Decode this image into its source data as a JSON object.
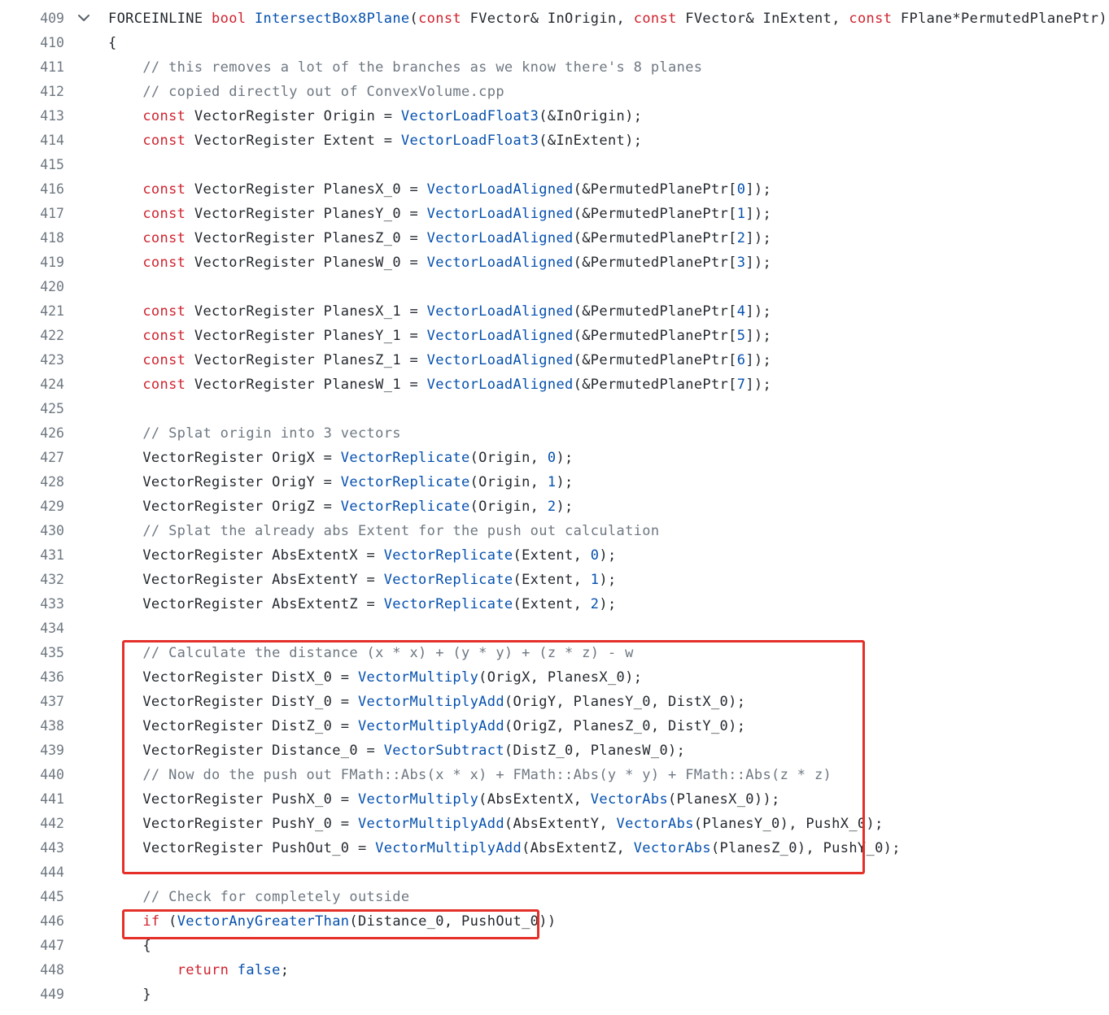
{
  "colors": {
    "keyword": "#cf222e",
    "function": "#0550ae",
    "comment": "#6e7781",
    "text": "#24292f",
    "line_number": "#6e7781",
    "highlight_box": "#e5302a"
  },
  "fold_icon": "chevron-down-icon",
  "lines": [
    {
      "n": "409",
      "fold": true,
      "tokens": [
        [
          "p",
          "FORCEINLINE "
        ],
        [
          "k",
          "bool"
        ],
        [
          "p",
          " "
        ],
        [
          "f",
          "IntersectBox8Plane"
        ],
        [
          "p",
          "("
        ],
        [
          "k",
          "const"
        ],
        [
          "p",
          " FVector& InOrigin, "
        ],
        [
          "k",
          "const"
        ],
        [
          "p",
          " FVector& InExtent, "
        ],
        [
          "k",
          "const"
        ],
        [
          "p",
          " FPlane*PermutedPlanePtr)"
        ]
      ]
    },
    {
      "n": "410",
      "tokens": [
        [
          "p",
          "{"
        ]
      ]
    },
    {
      "n": "411",
      "tokens": [
        [
          "p",
          "    "
        ],
        [
          "c",
          "// this removes a lot of the branches as we know there's 8 planes"
        ]
      ]
    },
    {
      "n": "412",
      "tokens": [
        [
          "p",
          "    "
        ],
        [
          "c",
          "// copied directly out of ConvexVolume.cpp"
        ]
      ]
    },
    {
      "n": "413",
      "tokens": [
        [
          "p",
          "    "
        ],
        [
          "k",
          "const"
        ],
        [
          "p",
          " VectorRegister Origin = "
        ],
        [
          "f",
          "VectorLoadFloat3"
        ],
        [
          "p",
          "(&InOrigin);"
        ]
      ]
    },
    {
      "n": "414",
      "tokens": [
        [
          "p",
          "    "
        ],
        [
          "k",
          "const"
        ],
        [
          "p",
          " VectorRegister Extent = "
        ],
        [
          "f",
          "VectorLoadFloat3"
        ],
        [
          "p",
          "(&InExtent);"
        ]
      ]
    },
    {
      "n": "415",
      "tokens": []
    },
    {
      "n": "416",
      "tokens": [
        [
          "p",
          "    "
        ],
        [
          "k",
          "const"
        ],
        [
          "p",
          " VectorRegister PlanesX_0 = "
        ],
        [
          "f",
          "VectorLoadAligned"
        ],
        [
          "p",
          "(&PermutedPlanePtr["
        ],
        [
          "n",
          "0"
        ],
        [
          "p",
          "]);"
        ]
      ]
    },
    {
      "n": "417",
      "tokens": [
        [
          "p",
          "    "
        ],
        [
          "k",
          "const"
        ],
        [
          "p",
          " VectorRegister PlanesY_0 = "
        ],
        [
          "f",
          "VectorLoadAligned"
        ],
        [
          "p",
          "(&PermutedPlanePtr["
        ],
        [
          "n",
          "1"
        ],
        [
          "p",
          "]);"
        ]
      ]
    },
    {
      "n": "418",
      "tokens": [
        [
          "p",
          "    "
        ],
        [
          "k",
          "const"
        ],
        [
          "p",
          " VectorRegister PlanesZ_0 = "
        ],
        [
          "f",
          "VectorLoadAligned"
        ],
        [
          "p",
          "(&PermutedPlanePtr["
        ],
        [
          "n",
          "2"
        ],
        [
          "p",
          "]);"
        ]
      ]
    },
    {
      "n": "419",
      "tokens": [
        [
          "p",
          "    "
        ],
        [
          "k",
          "const"
        ],
        [
          "p",
          " VectorRegister PlanesW_0 = "
        ],
        [
          "f",
          "VectorLoadAligned"
        ],
        [
          "p",
          "(&PermutedPlanePtr["
        ],
        [
          "n",
          "3"
        ],
        [
          "p",
          "]);"
        ]
      ]
    },
    {
      "n": "420",
      "tokens": []
    },
    {
      "n": "421",
      "tokens": [
        [
          "p",
          "    "
        ],
        [
          "k",
          "const"
        ],
        [
          "p",
          " VectorRegister PlanesX_1 = "
        ],
        [
          "f",
          "VectorLoadAligned"
        ],
        [
          "p",
          "(&PermutedPlanePtr["
        ],
        [
          "n",
          "4"
        ],
        [
          "p",
          "]);"
        ]
      ]
    },
    {
      "n": "422",
      "tokens": [
        [
          "p",
          "    "
        ],
        [
          "k",
          "const"
        ],
        [
          "p",
          " VectorRegister PlanesY_1 = "
        ],
        [
          "f",
          "VectorLoadAligned"
        ],
        [
          "p",
          "(&PermutedPlanePtr["
        ],
        [
          "n",
          "5"
        ],
        [
          "p",
          "]);"
        ]
      ]
    },
    {
      "n": "423",
      "tokens": [
        [
          "p",
          "    "
        ],
        [
          "k",
          "const"
        ],
        [
          "p",
          " VectorRegister PlanesZ_1 = "
        ],
        [
          "f",
          "VectorLoadAligned"
        ],
        [
          "p",
          "(&PermutedPlanePtr["
        ],
        [
          "n",
          "6"
        ],
        [
          "p",
          "]);"
        ]
      ]
    },
    {
      "n": "424",
      "tokens": [
        [
          "p",
          "    "
        ],
        [
          "k",
          "const"
        ],
        [
          "p",
          " VectorRegister PlanesW_1 = "
        ],
        [
          "f",
          "VectorLoadAligned"
        ],
        [
          "p",
          "(&PermutedPlanePtr["
        ],
        [
          "n",
          "7"
        ],
        [
          "p",
          "]);"
        ]
      ]
    },
    {
      "n": "425",
      "tokens": []
    },
    {
      "n": "426",
      "tokens": [
        [
          "p",
          "    "
        ],
        [
          "c",
          "// Splat origin into 3 vectors"
        ]
      ]
    },
    {
      "n": "427",
      "tokens": [
        [
          "p",
          "    VectorRegister OrigX = "
        ],
        [
          "f",
          "VectorReplicate"
        ],
        [
          "p",
          "(Origin, "
        ],
        [
          "n",
          "0"
        ],
        [
          "p",
          ");"
        ]
      ]
    },
    {
      "n": "428",
      "tokens": [
        [
          "p",
          "    VectorRegister OrigY = "
        ],
        [
          "f",
          "VectorReplicate"
        ],
        [
          "p",
          "(Origin, "
        ],
        [
          "n",
          "1"
        ],
        [
          "p",
          ");"
        ]
      ]
    },
    {
      "n": "429",
      "tokens": [
        [
          "p",
          "    VectorRegister OrigZ = "
        ],
        [
          "f",
          "VectorReplicate"
        ],
        [
          "p",
          "(Origin, "
        ],
        [
          "n",
          "2"
        ],
        [
          "p",
          ");"
        ]
      ]
    },
    {
      "n": "430",
      "tokens": [
        [
          "p",
          "    "
        ],
        [
          "c",
          "// Splat the already abs Extent for the push out calculation"
        ]
      ]
    },
    {
      "n": "431",
      "tokens": [
        [
          "p",
          "    VectorRegister AbsExtentX = "
        ],
        [
          "f",
          "VectorReplicate"
        ],
        [
          "p",
          "(Extent, "
        ],
        [
          "n",
          "0"
        ],
        [
          "p",
          ");"
        ]
      ]
    },
    {
      "n": "432",
      "tokens": [
        [
          "p",
          "    VectorRegister AbsExtentY = "
        ],
        [
          "f",
          "VectorReplicate"
        ],
        [
          "p",
          "(Extent, "
        ],
        [
          "n",
          "1"
        ],
        [
          "p",
          ");"
        ]
      ]
    },
    {
      "n": "433",
      "tokens": [
        [
          "p",
          "    VectorRegister AbsExtentZ = "
        ],
        [
          "f",
          "VectorReplicate"
        ],
        [
          "p",
          "(Extent, "
        ],
        [
          "n",
          "2"
        ],
        [
          "p",
          ");"
        ]
      ]
    },
    {
      "n": "434",
      "tokens": []
    },
    {
      "n": "435",
      "tokens": [
        [
          "p",
          "    "
        ],
        [
          "c",
          "// Calculate the distance (x * x) + (y * y) + (z * z) - w"
        ]
      ]
    },
    {
      "n": "436",
      "tokens": [
        [
          "p",
          "    VectorRegister DistX_0 = "
        ],
        [
          "f",
          "VectorMultiply"
        ],
        [
          "p",
          "(OrigX, PlanesX_0);"
        ]
      ]
    },
    {
      "n": "437",
      "tokens": [
        [
          "p",
          "    VectorRegister DistY_0 = "
        ],
        [
          "f",
          "VectorMultiplyAdd"
        ],
        [
          "p",
          "(OrigY, PlanesY_0, DistX_0);"
        ]
      ]
    },
    {
      "n": "438",
      "tokens": [
        [
          "p",
          "    VectorRegister DistZ_0 = "
        ],
        [
          "f",
          "VectorMultiplyAdd"
        ],
        [
          "p",
          "(OrigZ, PlanesZ_0, DistY_0);"
        ]
      ]
    },
    {
      "n": "439",
      "tokens": [
        [
          "p",
          "    VectorRegister Distance_0 = "
        ],
        [
          "f",
          "VectorSubtract"
        ],
        [
          "p",
          "(DistZ_0, PlanesW_0);"
        ]
      ]
    },
    {
      "n": "440",
      "tokens": [
        [
          "p",
          "    "
        ],
        [
          "c",
          "// Now do the push out FMath::Abs(x * x) + FMath::Abs(y * y) + FMath::Abs(z * z)"
        ]
      ]
    },
    {
      "n": "441",
      "tokens": [
        [
          "p",
          "    VectorRegister PushX_0 = "
        ],
        [
          "f",
          "VectorMultiply"
        ],
        [
          "p",
          "(AbsExtentX, "
        ],
        [
          "f",
          "VectorAbs"
        ],
        [
          "p",
          "(PlanesX_0));"
        ]
      ]
    },
    {
      "n": "442",
      "tokens": [
        [
          "p",
          "    VectorRegister PushY_0 = "
        ],
        [
          "f",
          "VectorMultiplyAdd"
        ],
        [
          "p",
          "(AbsExtentY, "
        ],
        [
          "f",
          "VectorAbs"
        ],
        [
          "p",
          "(PlanesY_0), PushX_0);"
        ]
      ]
    },
    {
      "n": "443",
      "tokens": [
        [
          "p",
          "    VectorRegister PushOut_0 = "
        ],
        [
          "f",
          "VectorMultiplyAdd"
        ],
        [
          "p",
          "(AbsExtentZ, "
        ],
        [
          "f",
          "VectorAbs"
        ],
        [
          "p",
          "(PlanesZ_0), PushY_0);"
        ]
      ]
    },
    {
      "n": "444",
      "tokens": []
    },
    {
      "n": "445",
      "tokens": [
        [
          "p",
          "    "
        ],
        [
          "c",
          "// Check for completely outside"
        ]
      ]
    },
    {
      "n": "446",
      "tokens": [
        [
          "p",
          "    "
        ],
        [
          "k",
          "if"
        ],
        [
          "p",
          " ("
        ],
        [
          "f",
          "VectorAnyGreaterThan"
        ],
        [
          "p",
          "(Distance_0, PushOut_0))"
        ]
      ]
    },
    {
      "n": "447",
      "tokens": [
        [
          "p",
          "    {"
        ]
      ]
    },
    {
      "n": "448",
      "tokens": [
        [
          "p",
          "        "
        ],
        [
          "k",
          "return"
        ],
        [
          "p",
          " "
        ],
        [
          "f",
          "false"
        ],
        [
          "p",
          ";"
        ]
      ]
    },
    {
      "n": "449",
      "tokens": [
        [
          "p",
          "    }"
        ]
      ]
    }
  ]
}
